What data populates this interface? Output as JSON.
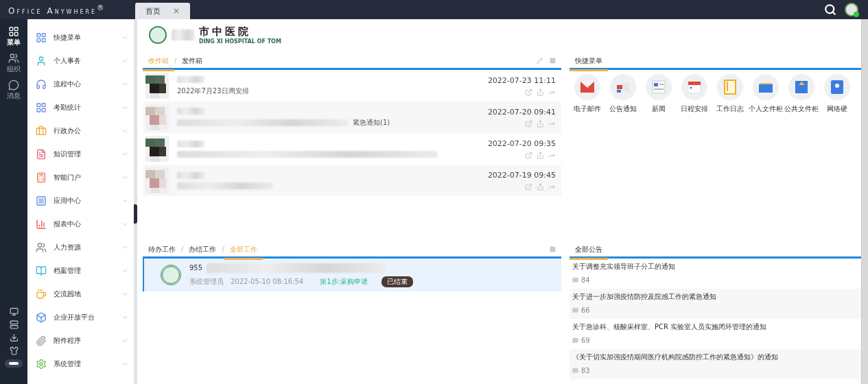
{
  "brand": {
    "name": "Office Anywhere",
    "mark": "®"
  },
  "tabs": [
    {
      "label": "首页",
      "close": "×",
      "selected": true
    }
  ],
  "rail": [
    {
      "label": "菜单",
      "selected": true
    },
    {
      "label": "组织",
      "selected": false
    },
    {
      "label": "消息",
      "selected": false
    }
  ],
  "menu": [
    {
      "label": "快捷菜单"
    },
    {
      "label": "个人事务"
    },
    {
      "label": "流程中心"
    },
    {
      "label": "考勤统计"
    },
    {
      "label": "行政办公"
    },
    {
      "label": "知识管理"
    },
    {
      "label": "智能门户"
    },
    {
      "label": "应用中心"
    },
    {
      "label": "报表中心"
    },
    {
      "label": "人力资源"
    },
    {
      "label": "档案管理"
    },
    {
      "label": "交流园地"
    },
    {
      "label": "企业开放平台"
    },
    {
      "label": "附件程序"
    },
    {
      "label": "系统管理"
    }
  ],
  "logo": {
    "name": "市中医院",
    "subtitle": "DING XI HOSPITAL OF TOM"
  },
  "mail": {
    "tabs": [
      {
        "label": "收件箱",
        "selected": true
      },
      {
        "label": "发件箱",
        "selected": false
      }
    ],
    "separator": "/",
    "messages": [
      {
        "redacted": false,
        "subject": "2022年7月23日周安排",
        "time": "2022-07-23 11:11"
      },
      {
        "redacted": true,
        "subject": "紧急通知(1)",
        "time": "2022-07-20 09:41"
      },
      {
        "redacted": true,
        "time": "2022-07-20 09:35"
      },
      {
        "redacted": true,
        "time": "2022-07-19 09:45"
      }
    ]
  },
  "quick_menu": {
    "title": "快捷菜单",
    "items": [
      {
        "label": "电子邮件"
      },
      {
        "label": "公告通知"
      },
      {
        "label": "新闻"
      },
      {
        "label": "日程安排"
      },
      {
        "label": "工作日志"
      },
      {
        "label": "个人文件柜"
      },
      {
        "label": "公共文件柜"
      },
      {
        "label": "网络硬"
      }
    ]
  },
  "work": {
    "tabs": [
      {
        "label": "待办工作",
        "selected": false
      },
      {
        "label": "办结工作",
        "selected": false
      },
      {
        "label": "全部工作",
        "selected": true
      }
    ],
    "separator": "/",
    "rows": [
      {
        "number": "955",
        "user": "系统管理员",
        "time": "2022-05-10 08:16:54",
        "step": "第1步:采购申请",
        "status": "已结束",
        "selected": true
      }
    ]
  },
  "notices": {
    "title": "全部公告",
    "items": [
      {
        "title": "关于调整充实领导班子分工的通知",
        "count": "84"
      },
      {
        "title": "关于进一步加强疫情防控及院感工作的紧急通知",
        "count": "66"
      },
      {
        "title": "关于急诊科、核酸采样室、PCR 实验室人员实施闭环管理的通知",
        "count": "69"
      },
      {
        "title": "《关于切实加强疫情期间医疗机构院感防控工作的紧急通知》的通知",
        "count": "83"
      }
    ]
  }
}
